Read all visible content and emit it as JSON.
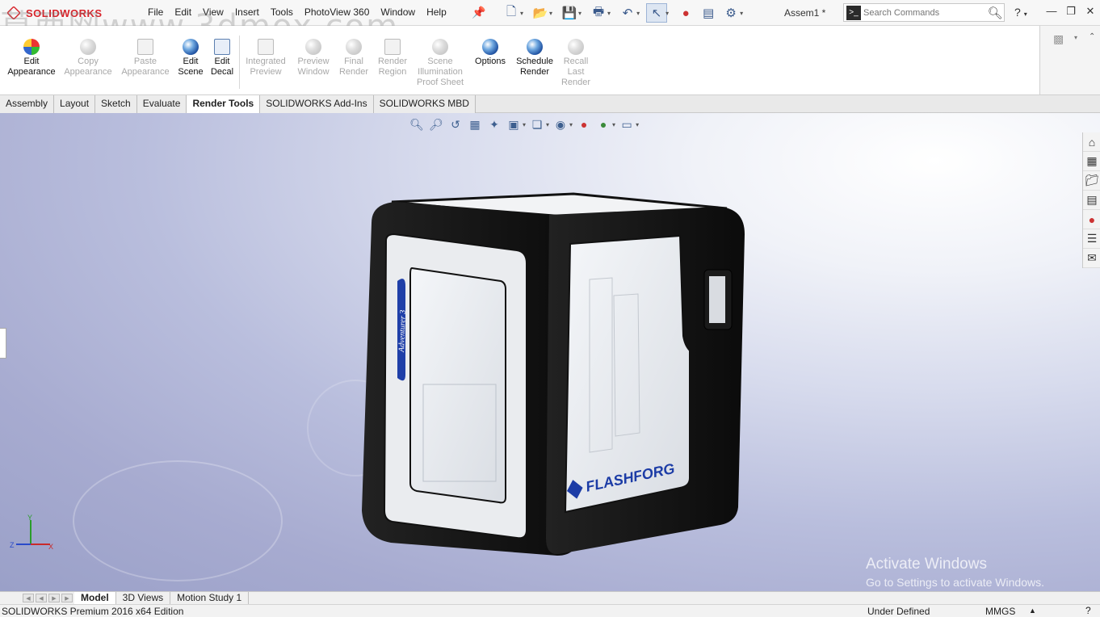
{
  "app": {
    "brand": "SOLIDWORKS",
    "doc_title": "Assem1 *"
  },
  "overlay_watermark": "莫西网www.3dmox.com",
  "menu": [
    "File",
    "Edit",
    "View",
    "Insert",
    "Tools",
    "PhotoView 360",
    "Window",
    "Help"
  ],
  "search": {
    "placeholder": "Search Commands"
  },
  "ribbon": {
    "buttons": [
      {
        "label": "Edit\nAppearance",
        "enabled": true
      },
      {
        "label": "Copy\nAppearance",
        "enabled": false
      },
      {
        "label": "Paste\nAppearance",
        "enabled": false
      },
      {
        "label": "Edit\nScene",
        "enabled": true
      },
      {
        "label": "Edit\nDecal",
        "enabled": true
      },
      {
        "label": "Integrated\nPreview",
        "enabled": false
      },
      {
        "label": "Preview\nWindow",
        "enabled": false
      },
      {
        "label": "Final\nRender",
        "enabled": false
      },
      {
        "label": "Render\nRegion",
        "enabled": false
      },
      {
        "label": "Scene\nIllumination\nProof Sheet",
        "enabled": false
      },
      {
        "label": "Options",
        "enabled": true
      },
      {
        "label": "Schedule\nRender",
        "enabled": true
      },
      {
        "label": "Recall\nLast\nRender",
        "enabled": false
      }
    ]
  },
  "tabs": [
    "Assembly",
    "Layout",
    "Sketch",
    "Evaluate",
    "Render Tools",
    "SOLIDWORKS Add-Ins",
    "SOLIDWORKS MBD"
  ],
  "active_tab": "Render Tools",
  "model": {
    "brand_text": "FLASHFORG",
    "door_text": "Adventurer 3"
  },
  "triad": {
    "y": "Y",
    "z": "Z",
    "x": "X"
  },
  "activation": {
    "line1": "Activate Windows",
    "line2": "Go to Settings to activate Windows."
  },
  "bottom_tabs": [
    "Model",
    "3D Views",
    "Motion Study 1"
  ],
  "active_bottom_tab": "Model",
  "status": {
    "left": "SOLIDWORKS Premium 2016 x64 Edition",
    "state": "Under Defined",
    "units": "MMGS"
  }
}
